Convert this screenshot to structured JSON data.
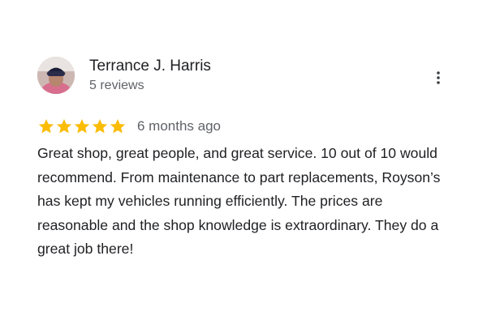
{
  "reviewer": {
    "name": "Terrance J. Harris",
    "meta": "5 reviews",
    "avatar_icon": "user-photo"
  },
  "more_menu_icon": "more-vert-icon",
  "rating": {
    "stars": 5,
    "max_stars": 5,
    "star_color": "#fbbc04",
    "date": "6 months ago"
  },
  "review": {
    "text": "Great shop, great people, and great service. 10 out of 10 would recommend. From maintenance to part replacements, Royson’s has kept my vehicles running efficiently. The prices are reasonable and the shop knowledge is extraordinary. They do a great job there!"
  }
}
